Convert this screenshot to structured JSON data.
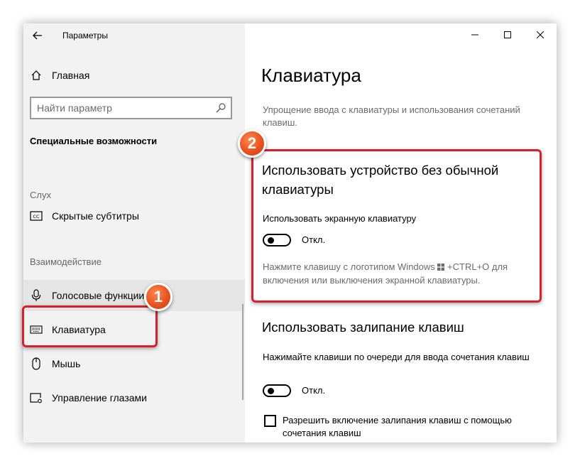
{
  "app": {
    "title": "Параметры"
  },
  "sidebar": {
    "home": "Главная",
    "search": {
      "placeholder": "Найти параметр",
      "value": ""
    },
    "section": "Специальные возможности",
    "groups": [
      "Слух",
      "Взаимодействие"
    ],
    "items": [
      {
        "label": "Скрытые субтитры",
        "icon": "closed-captions-icon"
      },
      {
        "label": "Голосовые функции",
        "icon": "microphone-icon"
      },
      {
        "label": "Клавиатура",
        "icon": "keyboard-icon"
      },
      {
        "label": "Мышь",
        "icon": "mouse-icon"
      },
      {
        "label": "Управление глазами",
        "icon": "eye-control-icon"
      }
    ]
  },
  "main": {
    "title": "Клавиатура",
    "description": "Упрощение ввода с клавиатуры и использования сочетаний клавиш.",
    "section1": {
      "heading": "Использовать устройство без обычной клавиатуры",
      "setting_label": "Использовать экранную клавиатуру",
      "toggle_state": "Откл.",
      "note_before": "Нажмите клавишу с логотипом Windows",
      "note_after": "+CTRL+O для включения или выключения экранной клавиатуры."
    },
    "section2": {
      "heading": "Использовать залипание клавиш",
      "setting_label": "Нажимайте клавиши по очереди для ввода сочетания клавиш",
      "toggle_state": "Откл.",
      "checkbox_label": "Разрешить включение залипания клавиш с помощью сочетания клавиш"
    }
  },
  "annotations": {
    "badge1": "1",
    "badge2": "2"
  },
  "colors": {
    "highlight": "#d6202c",
    "badge": "#e8521f",
    "sidebar_bg": "#f2f2f2",
    "hover_bg": "#e5e5e5"
  }
}
